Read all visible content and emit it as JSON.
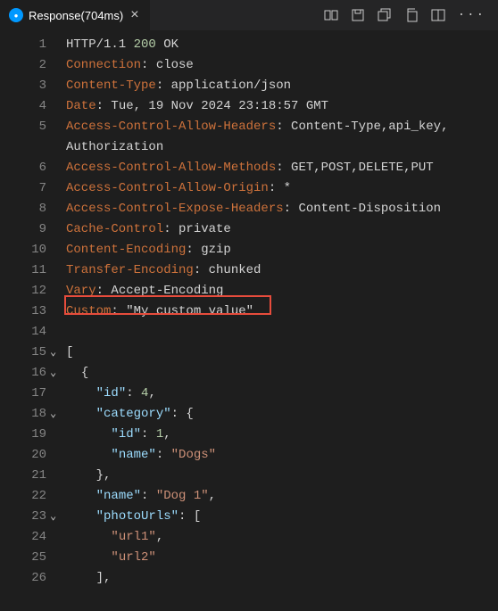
{
  "tab": {
    "title": "Response(704ms)"
  },
  "http": {
    "protocol": "HTTP/1.1",
    "status_code": "200",
    "status_text": "OK"
  },
  "headers": [
    {
      "key": "Connection",
      "value": "close"
    },
    {
      "key": "Content-Type",
      "value": "application/json"
    },
    {
      "key": "Date",
      "value": "Tue, 19 Nov 2024 23:18:57 GMT"
    },
    {
      "key": "Access-Control-Allow-Headers",
      "value": "Content-Type,api_key, Authorization",
      "wrap": true
    },
    {
      "key": "Access-Control-Allow-Methods",
      "value": "GET,POST,DELETE,PUT"
    },
    {
      "key": "Access-Control-Allow-Origin",
      "value": "*"
    },
    {
      "key": "Access-Control-Expose-Headers",
      "value": "Content-Disposition"
    },
    {
      "key": "Cache-Control",
      "value": "private"
    },
    {
      "key": "Content-Encoding",
      "value": "gzip"
    },
    {
      "key": "Transfer-Encoding",
      "value": "chunked"
    },
    {
      "key": "Vary",
      "value": "Accept-Encoding"
    },
    {
      "key": "Custom",
      "value": "\"My custom value\"",
      "highlighted": true
    }
  ],
  "body_lines": [
    {
      "n": 15,
      "fold": "v",
      "text": "[",
      "cls": "br"
    },
    {
      "n": 16,
      "fold": "v",
      "indent": "  ",
      "text": "{",
      "cls": "br"
    },
    {
      "n": 17,
      "indent": "    ",
      "segments": [
        {
          "t": "\"id\"",
          "c": "pk"
        },
        {
          "t": ": ",
          "c": "br"
        },
        {
          "t": "4",
          "c": "num"
        },
        {
          "t": ",",
          "c": "br"
        }
      ]
    },
    {
      "n": 18,
      "fold": "v",
      "indent": "    ",
      "segments": [
        {
          "t": "\"category\"",
          "c": "pk"
        },
        {
          "t": ": {",
          "c": "br"
        }
      ]
    },
    {
      "n": 19,
      "indent": "      ",
      "segments": [
        {
          "t": "\"id\"",
          "c": "pk"
        },
        {
          "t": ": ",
          "c": "br"
        },
        {
          "t": "1",
          "c": "num"
        },
        {
          "t": ",",
          "c": "br"
        }
      ]
    },
    {
      "n": 20,
      "indent": "      ",
      "segments": [
        {
          "t": "\"name\"",
          "c": "pk"
        },
        {
          "t": ": ",
          "c": "br"
        },
        {
          "t": "\"Dogs\"",
          "c": "str"
        }
      ]
    },
    {
      "n": 21,
      "indent": "    ",
      "text": "},",
      "cls": "br"
    },
    {
      "n": 22,
      "indent": "    ",
      "segments": [
        {
          "t": "\"name\"",
          "c": "pk"
        },
        {
          "t": ": ",
          "c": "br"
        },
        {
          "t": "\"Dog 1\"",
          "c": "str"
        },
        {
          "t": ",",
          "c": "br"
        }
      ]
    },
    {
      "n": 23,
      "fold": "v",
      "indent": "    ",
      "segments": [
        {
          "t": "\"photoUrls\"",
          "c": "pk"
        },
        {
          "t": ": [",
          "c": "br"
        }
      ]
    },
    {
      "n": 24,
      "indent": "      ",
      "segments": [
        {
          "t": "\"url1\"",
          "c": "str"
        },
        {
          "t": ",",
          "c": "br"
        }
      ]
    },
    {
      "n": 25,
      "indent": "      ",
      "segments": [
        {
          "t": "\"url2\"",
          "c": "str"
        }
      ]
    },
    {
      "n": 26,
      "indent": "    ",
      "text": "],",
      "cls": "br"
    }
  ],
  "line_numbers": [
    1,
    2,
    3,
    4,
    5,
    5,
    6,
    7,
    8,
    9,
    10,
    11,
    12,
    13,
    14
  ]
}
